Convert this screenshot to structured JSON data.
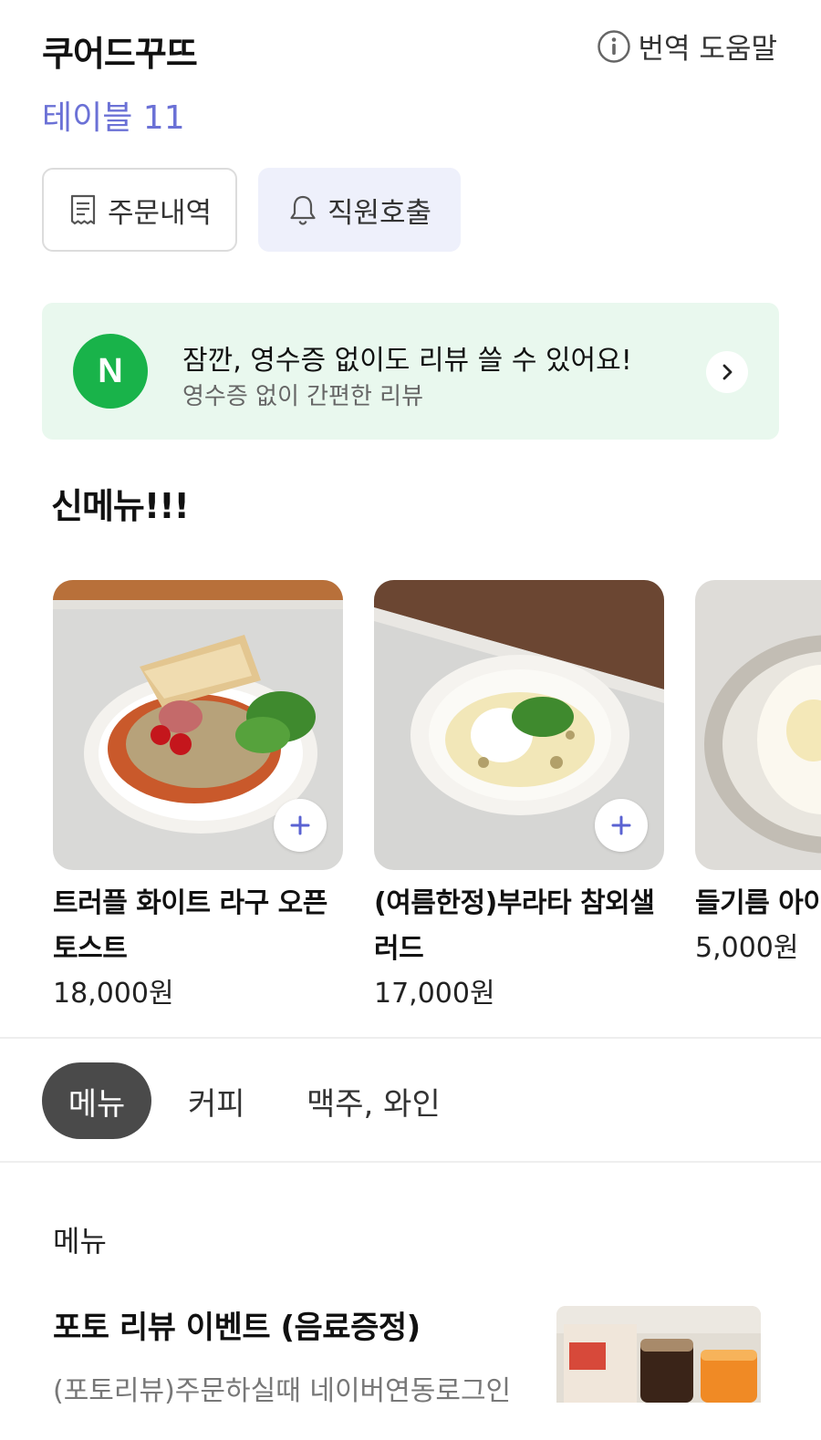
{
  "header": {
    "store_name": "쿠어드꾸뜨",
    "help_label": "번역 도움말",
    "table_label": "테이블 11"
  },
  "actions": {
    "orders_label": "주문내역",
    "call_staff_label": "직원호출"
  },
  "review_banner": {
    "logo_letter": "N",
    "title": "잠깐, 영수증 없이도 리뷰 쓸 수 있어요!",
    "subtitle": "영수증 없이 간편한 리뷰"
  },
  "new_menu": {
    "title": "신메뉴!!!",
    "items": [
      {
        "name": "트러플 화이트 라구 오픈 토스트",
        "price": "18,000원"
      },
      {
        "name": "(여름한정)부라타 참외샐러드",
        "price": "17,000원"
      },
      {
        "name": "들기름 아이",
        "price": "5,000원"
      }
    ]
  },
  "tabs": [
    {
      "label": "메뉴",
      "active": true
    },
    {
      "label": "커피",
      "active": false
    },
    {
      "label": "맥주, 와인",
      "active": false
    }
  ],
  "menu_section": {
    "category": "메뉴",
    "item": {
      "title": "포토 리뷰 이벤트 (음료증정)",
      "description": "(포토리뷰)주문하실때 네이버연동로그인"
    }
  },
  "colors": {
    "accent": "#6b71d6",
    "naver_green": "#19b34a",
    "banner_bg": "#e9f8ee",
    "call_bg": "#eef0fb",
    "active_tab": "#4a4a4a"
  },
  "icons": {
    "help": "info-circle-icon",
    "orders": "receipt-icon",
    "call": "bell-icon",
    "banner_arrow": "chevron-right-icon",
    "add": "plus-icon"
  }
}
